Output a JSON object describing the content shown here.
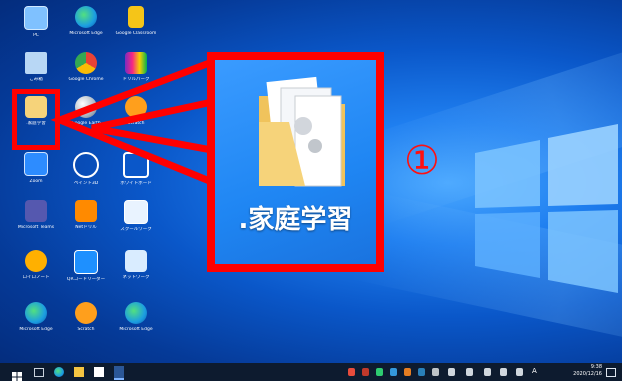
{
  "desktop": {
    "icons": [
      {
        "label": "PC",
        "icon": "pc-icon"
      },
      {
        "label": "Microsoft Edge",
        "icon": "edge-icon"
      },
      {
        "label": "Google Classroom",
        "icon": "classroom-icon"
      },
      {
        "label": "ごみ箱",
        "icon": "recycle-bin-icon"
      },
      {
        "label": "Google Chrome",
        "icon": "chrome-icon"
      },
      {
        "label": "ドリルパーク",
        "icon": "drill-park-icon"
      },
      {
        "label": ".家庭学習",
        "icon": "folder-icon"
      },
      {
        "label": "Google Earth",
        "icon": "earth-icon"
      },
      {
        "label": "Scratch",
        "icon": "scratch-icon"
      },
      {
        "label": "Zoom",
        "icon": "zoom-icon"
      },
      {
        "label": "ペイント3D",
        "icon": "pen-icon"
      },
      {
        "label": "ホワイトボード",
        "icon": "whiteboard-icon"
      },
      {
        "label": "Microsoft Teams",
        "icon": "teams-icon"
      },
      {
        "label": "Netドリル",
        "icon": "net-drill-icon"
      },
      {
        "label": "スクールワーク",
        "icon": "schoolwork-icon"
      },
      {
        "label": "ロイロノート",
        "icon": "loilo-icon"
      },
      {
        "label": "QRコードリーダー",
        "icon": "qr-icon"
      },
      {
        "label": "ネットワーク",
        "icon": "network-icon"
      },
      {
        "label": "Microsoft Edge",
        "icon": "edge-icon"
      },
      {
        "label": "Scratch",
        "icon": "scratch-icon"
      },
      {
        "label": "Microsoft Edge",
        "icon": "edge-icon"
      }
    ]
  },
  "zoom": {
    "label": ".家庭学習"
  },
  "callout": {
    "number": "①"
  },
  "taskbar": {
    "time": "9:38",
    "date": "2020/12/16",
    "ime": "A"
  },
  "colors": {
    "highlight": "#ff0000",
    "taskbar": "#0d1b2f"
  }
}
